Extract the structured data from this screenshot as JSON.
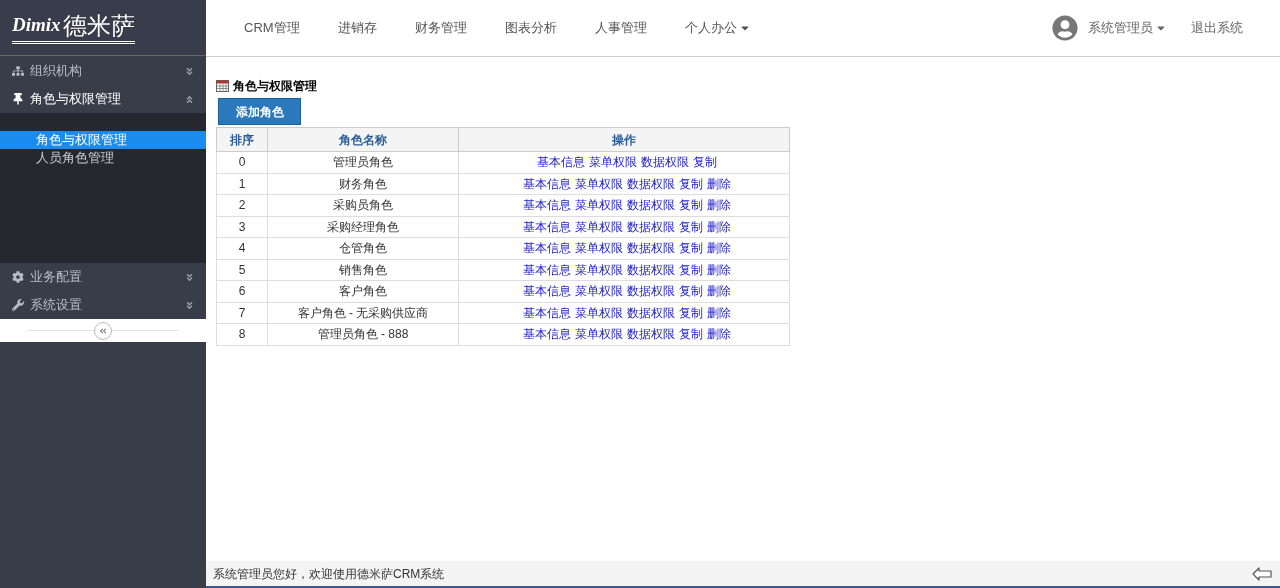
{
  "logo": {
    "brand": "Dimix",
    "name": "德米萨"
  },
  "top_nav": [
    {
      "label": "CRM管理",
      "kind": "link"
    },
    {
      "label": "进销存",
      "kind": "link"
    },
    {
      "label": "财务管理",
      "kind": "link"
    },
    {
      "label": "图表分析",
      "kind": "link"
    },
    {
      "label": "人事管理",
      "kind": "link"
    },
    {
      "label": "个人办公",
      "kind": "dropdown"
    }
  ],
  "user": {
    "name": "系统管理员",
    "logout": "退出系统"
  },
  "sidebar": [
    {
      "label": "组织机构",
      "expanded": false
    },
    {
      "label": "角色与权限管理",
      "expanded": true,
      "children": [
        {
          "label": "角色与权限管理",
          "selected": true
        },
        {
          "label": "人员角色管理",
          "selected": false
        }
      ]
    },
    {
      "label": "业务配置",
      "expanded": false
    },
    {
      "label": "系统设置",
      "expanded": false
    }
  ],
  "page_title": "角色与权限管理",
  "add_button": "添加角色",
  "table": {
    "columns": [
      "排序",
      "角色名称",
      "操作"
    ],
    "rows": [
      {
        "order": "0",
        "name": "管理员角色",
        "actions": [
          "基本信息",
          "菜单权限",
          "数据权限",
          "复制"
        ]
      },
      {
        "order": "1",
        "name": "财务角色",
        "actions": [
          "基本信息",
          "菜单权限",
          "数据权限",
          "复制",
          "删除"
        ]
      },
      {
        "order": "2",
        "name": "采购员角色",
        "actions": [
          "基本信息",
          "菜单权限",
          "数据权限",
          "复制",
          "删除"
        ]
      },
      {
        "order": "3",
        "name": "采购经理角色",
        "actions": [
          "基本信息",
          "菜单权限",
          "数据权限",
          "复制",
          "删除"
        ]
      },
      {
        "order": "4",
        "name": "仓管角色",
        "actions": [
          "基本信息",
          "菜单权限",
          "数据权限",
          "复制",
          "删除"
        ]
      },
      {
        "order": "5",
        "name": "销售角色",
        "actions": [
          "基本信息",
          "菜单权限",
          "数据权限",
          "复制",
          "删除"
        ]
      },
      {
        "order": "6",
        "name": "客户角色",
        "actions": [
          "基本信息",
          "菜单权限",
          "数据权限",
          "复制",
          "删除"
        ]
      },
      {
        "order": "7",
        "name": "客户角色 - 无采购供应商",
        "actions": [
          "基本信息",
          "菜单权限",
          "数据权限",
          "复制",
          "删除"
        ]
      },
      {
        "order": "8",
        "name": "管理员角色 - 888",
        "actions": [
          "基本信息",
          "菜单权限",
          "数据权限",
          "复制",
          "删除"
        ]
      }
    ]
  },
  "status_bar": "系统管理员您好，欢迎使用德米萨CRM系统"
}
